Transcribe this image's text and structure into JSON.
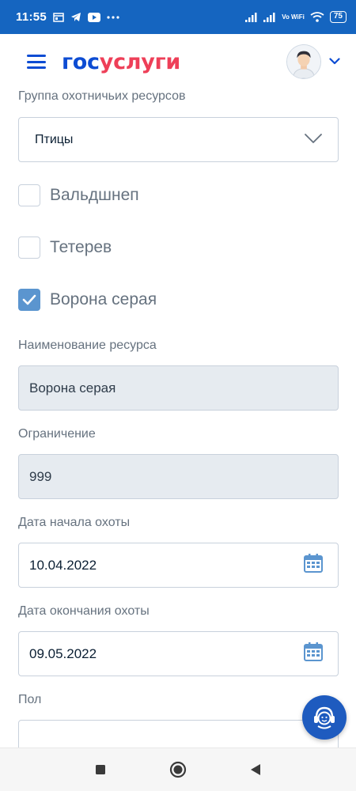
{
  "status_bar": {
    "time": "11:55",
    "network_label": "Vo WiFi",
    "battery": "75"
  },
  "header": {
    "logo_part1": "гос",
    "logo_part2": "услуги"
  },
  "form": {
    "group_label": "Группа охотничьих ресурсов",
    "group_value": "Птицы",
    "checkboxes": [
      {
        "label": "Вальдшнеп",
        "checked": false
      },
      {
        "label": "Тетерев",
        "checked": false
      },
      {
        "label": "Ворона серая",
        "checked": true
      }
    ],
    "resource_name_label": "Наименование ресурса",
    "resource_name_value": "Ворона серая",
    "limit_label": "Ограничение",
    "limit_value": "999",
    "start_date_label": "Дата начала охоты",
    "start_date_value": "10.04.2022",
    "end_date_label": "Дата окончания охоты",
    "end_date_value": "09.05.2022",
    "sex_label": "Пол",
    "sex_value": ""
  },
  "colors": {
    "brand_blue": "#0d4cd3",
    "brand_red": "#ee3f58",
    "status_bar": "#1565c0",
    "checkbox_checked": "#5b95cf"
  },
  "icons": [
    "menu-icon",
    "chevron-down-icon",
    "calendar-icon",
    "support-chat-icon",
    "nav-recents-icon",
    "nav-home-icon",
    "nav-back-icon"
  ]
}
